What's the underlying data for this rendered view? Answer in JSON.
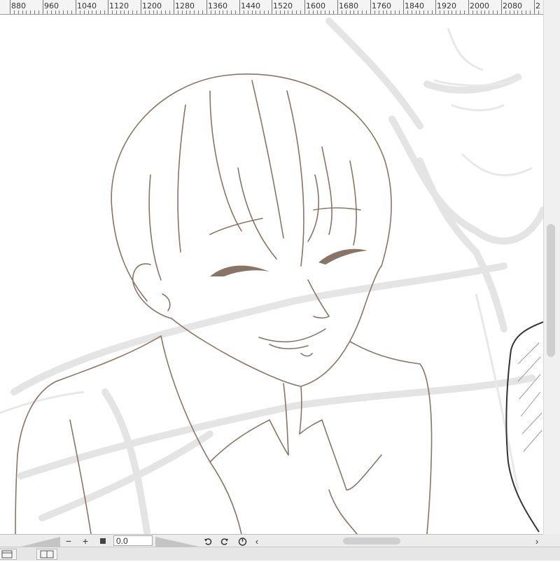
{
  "ruler": {
    "labels": [
      "880",
      "960",
      "1040",
      "1120",
      "1200",
      "1280",
      "1360",
      "1440",
      "1520",
      "1600",
      "1680",
      "1760",
      "1840",
      "1920",
      "2000",
      "2080",
      "2"
    ]
  },
  "bottom_bar": {
    "zoom_out_label": "−",
    "zoom_in_label": "+",
    "zoom_value": "0.0",
    "undo_icon": "undo-icon",
    "redo_icon": "redo-icon",
    "reset_icon": "reset-rotation-icon",
    "scroll_left": "‹",
    "scroll_right": "›"
  },
  "colors": {
    "line_art": "#8a7466",
    "sketch": "#dcdcdc",
    "ruler_bg": "#f4f4f4",
    "panel_bg": "#ececec"
  },
  "icons": [
    "navigator-icon",
    "layout-icon",
    "stop-icon"
  ]
}
